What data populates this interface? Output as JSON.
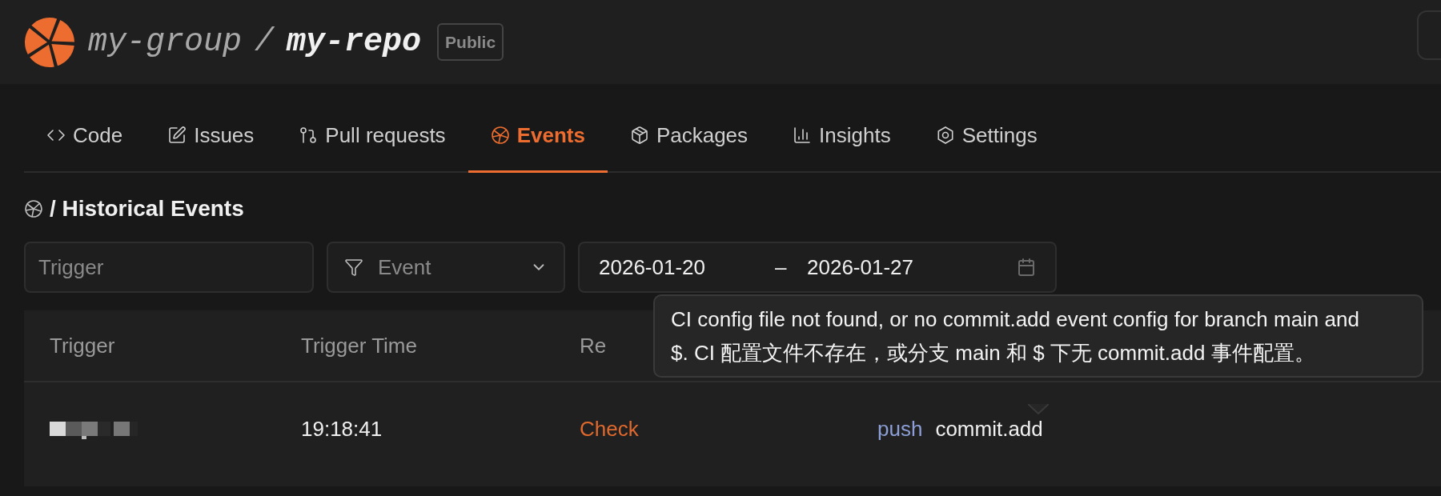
{
  "repo": {
    "group": "my-group",
    "separator": "/",
    "name": "my-repo",
    "visibility": "Public"
  },
  "tabs": [
    {
      "label": "Code",
      "selected": false
    },
    {
      "label": "Issues",
      "selected": false
    },
    {
      "label": "Pull requests",
      "selected": false
    },
    {
      "label": "Events",
      "selected": true
    },
    {
      "label": "Packages",
      "selected": false
    },
    {
      "label": "Insights",
      "selected": false
    },
    {
      "label": "Settings",
      "selected": false
    }
  ],
  "page_title": "/ Historical Events",
  "filters": {
    "trigger": {
      "placeholder": "Trigger"
    },
    "event": {
      "placeholder": "Event"
    },
    "date_range": {
      "start": "2026-01-20",
      "separator": "–",
      "end": "2026-01-27"
    }
  },
  "table": {
    "columns": [
      "Trigger",
      "Trigger Time",
      "Re"
    ],
    "rows": [
      {
        "time": "19:18:41",
        "result": "Check",
        "event_type": "push",
        "event": "commit.add"
      }
    ]
  },
  "tooltip": {
    "text": "CI config file not found, or no commit.add event config for branch main and $. CI 配置文件不存在，或分支 main 和 $ 下无 commit.add 事件配置。"
  }
}
